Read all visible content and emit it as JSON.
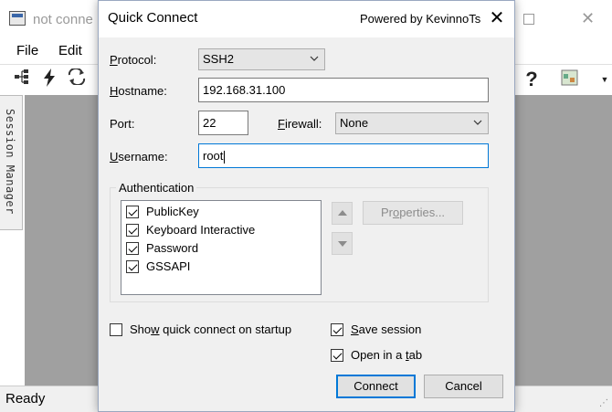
{
  "background_app": {
    "window_title": "not conne",
    "menu": [
      "File",
      "Edit"
    ],
    "toolbar_icons": [
      "tree-icon",
      "lightning-icon",
      "reconnect-icon",
      "help-icon",
      "palette-icon",
      "dropdown-arrow-icon"
    ],
    "session_manager_tab": "Session Manager",
    "status": "Ready",
    "colors": {
      "workspace": "#a0a0a0"
    }
  },
  "dialog": {
    "title": "Quick Connect",
    "powered_by": "Powered by KevinnoTs",
    "close_glyph": "✕",
    "protocol": {
      "label_accel": "P",
      "label_rest": "rotocol:",
      "value": "SSH2"
    },
    "hostname": {
      "label_accel": "H",
      "label_rest": "ostname:",
      "value": "192.168.31.100"
    },
    "port": {
      "label_accel": "",
      "label_rest": "Port:",
      "value": "22"
    },
    "firewall": {
      "label_accel": "F",
      "label_rest": "irewall:",
      "value": "None"
    },
    "username": {
      "label_accel": "U",
      "label_rest": "sername:",
      "value": "root"
    },
    "authentication": {
      "legend": "Authentication",
      "methods": [
        {
          "label": "PublicKey",
          "checked": true
        },
        {
          "label": "Keyboard Interactive",
          "checked": true
        },
        {
          "label": "Password",
          "checked": true
        },
        {
          "label": "GSSAPI",
          "checked": true
        }
      ],
      "properties_pre": "Pr",
      "properties_accel": "o",
      "properties_post": "perties..."
    },
    "show_on_startup": {
      "pre": "Sho",
      "accel": "w",
      "post": " quick connect on startup",
      "checked": false
    },
    "save_session": {
      "pre": "",
      "accel": "S",
      "post": "ave session",
      "checked": true
    },
    "open_in_tab": {
      "pre": "Open in a ",
      "accel": "t",
      "post": "ab",
      "checked": true
    },
    "connect_label": "Connect",
    "cancel_label": "Cancel",
    "colors": {
      "focus_border": "#0078d7",
      "face": "#f0f0f0"
    }
  }
}
